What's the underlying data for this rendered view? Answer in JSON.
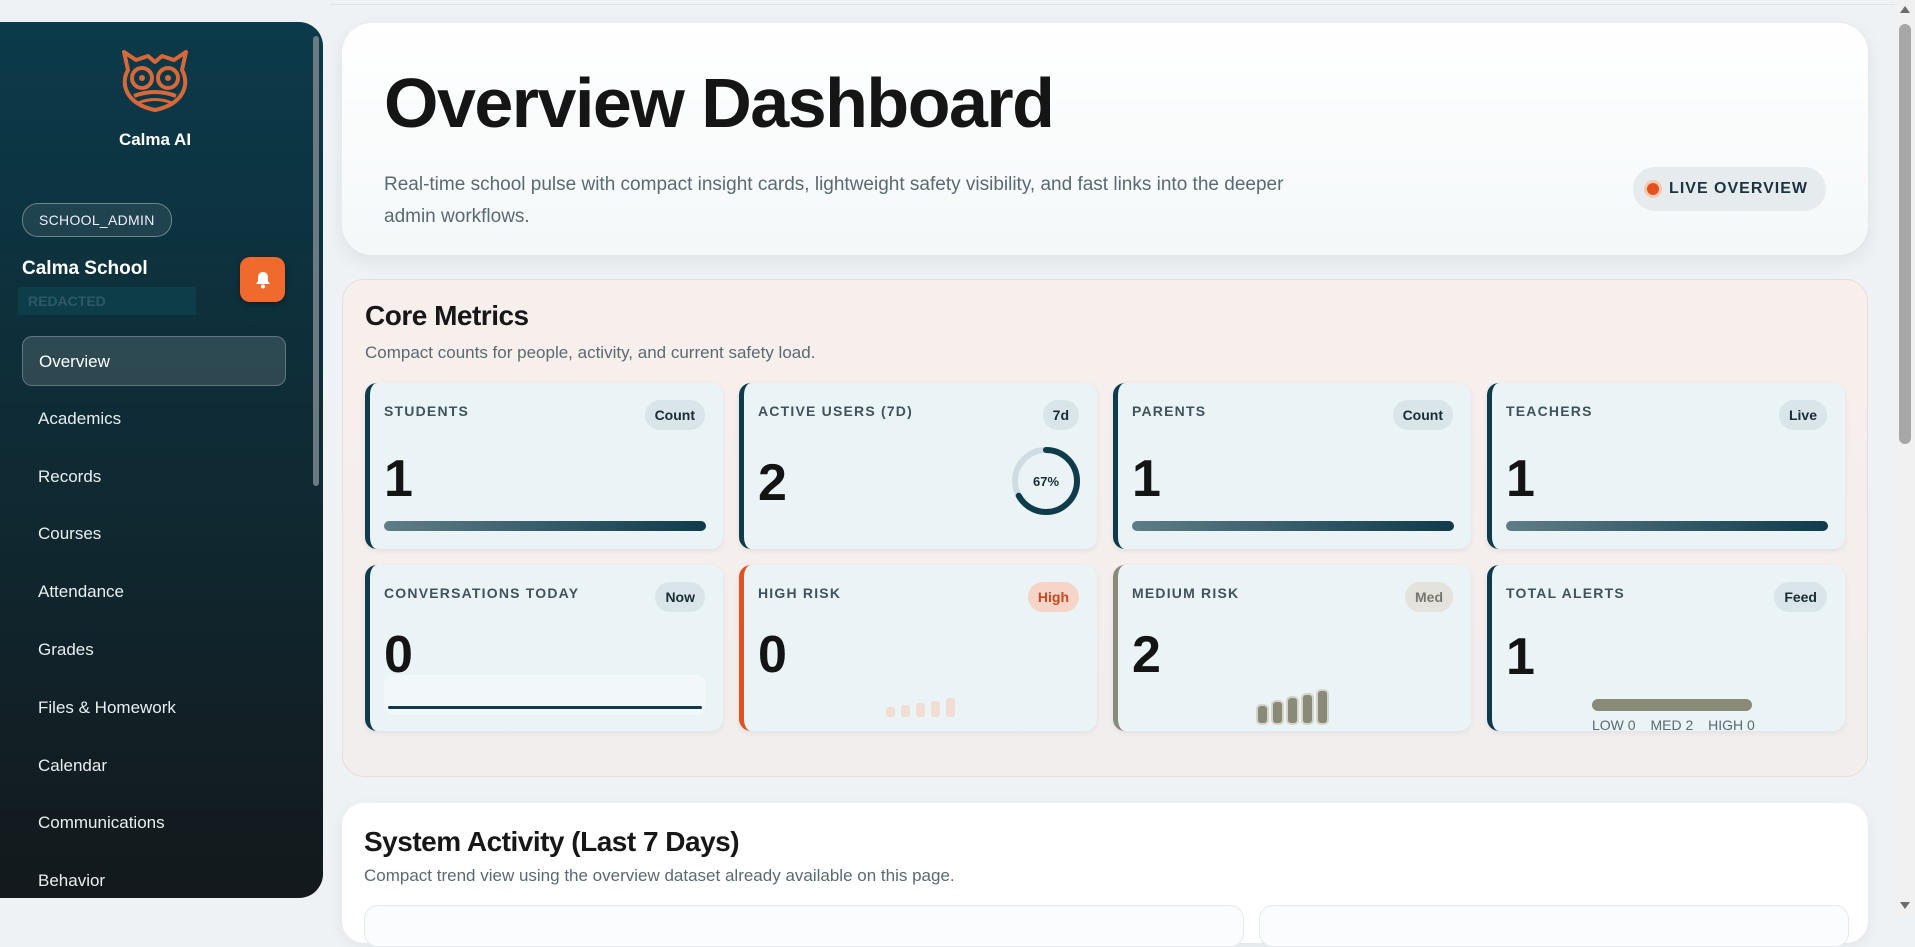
{
  "sidebar": {
    "brand": "Calma AI",
    "role": "SCHOOL_ADMIN",
    "school_name": "Calma School",
    "school_sub": "REDACTED",
    "notification_icon": "bell-icon",
    "logo_icon": "owl-logo",
    "items": [
      {
        "label": "Overview",
        "active": true
      },
      {
        "label": "Academics"
      },
      {
        "label": "Records"
      },
      {
        "label": "Courses"
      },
      {
        "label": "Attendance"
      },
      {
        "label": "Grades"
      },
      {
        "label": "Files & Homework"
      },
      {
        "label": "Calendar"
      },
      {
        "label": "Communications"
      },
      {
        "label": "Behavior"
      }
    ]
  },
  "hero": {
    "title": "Overview Dashboard",
    "description": "Real-time school pulse with compact insight cards, lightweight safety visibility, and fast links into the deeper admin workflows.",
    "status": "LIVE OVERVIEW"
  },
  "core": {
    "title": "Core Metrics",
    "subtitle": "Compact counts for people, activity, and current safety load.",
    "cards": [
      {
        "label": "STUDENTS",
        "badge": "Count",
        "value": "1"
      },
      {
        "label": "ACTIVE USERS (7D)",
        "badge": "7d",
        "value": "2",
        "ring": "67%",
        "ring_fraction": 0.67
      },
      {
        "label": "PARENTS",
        "badge": "Count",
        "value": "1"
      },
      {
        "label": "TEACHERS",
        "badge": "Live",
        "value": "1"
      },
      {
        "label": "CONVERSATIONS TODAY",
        "badge": "Now",
        "value": "0"
      },
      {
        "label": "HIGH RISK",
        "badge": "High",
        "value": "0"
      },
      {
        "label": "MEDIUM RISK",
        "badge": "Med",
        "value": "2"
      },
      {
        "label": "TOTAL ALERTS",
        "badge": "Feed",
        "value": "1",
        "breakdown": [
          "LOW 0",
          "MED 2",
          "HIGH 0"
        ]
      }
    ]
  },
  "system": {
    "title": "System Activity (Last 7 Days)",
    "subtitle": "Compact trend view using the overview dataset already available on this page."
  },
  "colors": {
    "accent": "#ef6a2c",
    "primary": "#0f3b4a",
    "high": "#e2521f",
    "medium": "#8a8a78"
  }
}
